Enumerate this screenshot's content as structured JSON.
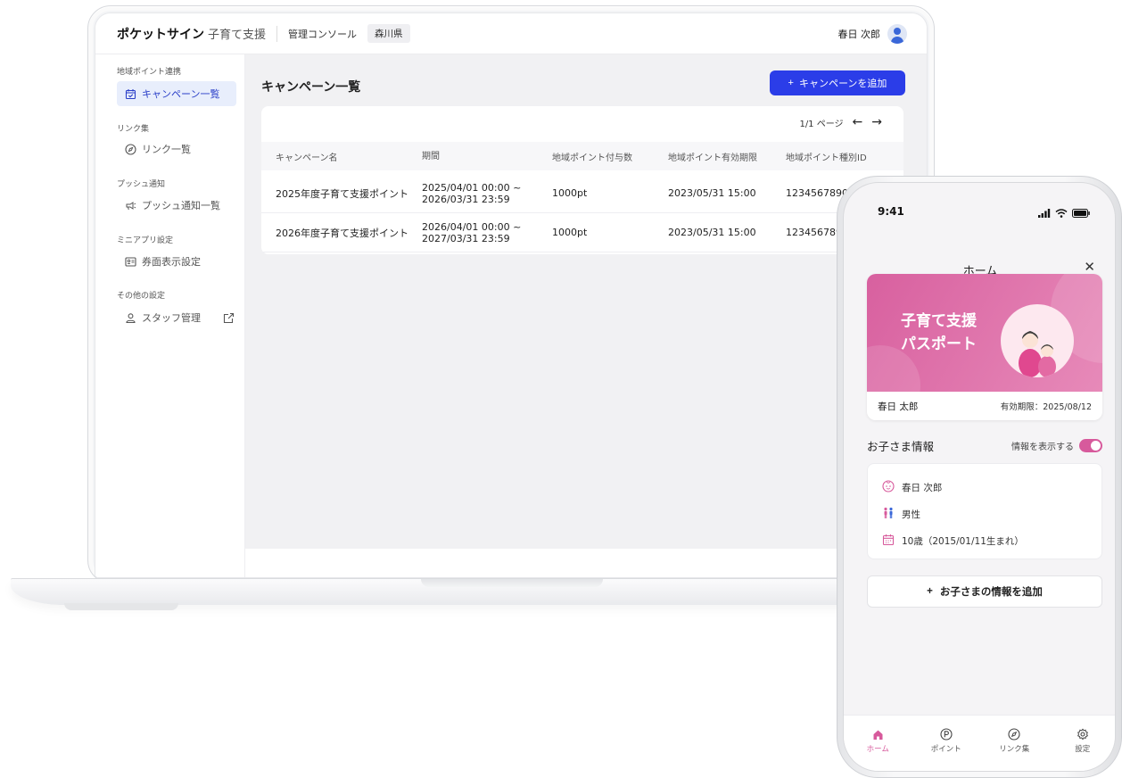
{
  "console": {
    "brand": "ポケットサイン",
    "brand_sub": "子育て支援",
    "nav_link": "管理コンソール",
    "prefecture": "森川県",
    "user_name": "春日 次郎"
  },
  "sidebar": {
    "sections": [
      {
        "label": "地域ポイント連携",
        "item": "キャンペーン一覧",
        "icon": "calendar-check-icon",
        "active": true
      },
      {
        "label": "リンク集",
        "item": "リンク一覧",
        "icon": "compass-icon"
      },
      {
        "label": "プッシュ通知",
        "item": "プッシュ通知一覧",
        "icon": "megaphone-icon"
      },
      {
        "label": "ミニアプリ設定",
        "item": "券面表示設定",
        "icon": "id-card-icon"
      },
      {
        "label": "その他の設定",
        "item": "スタッフ管理",
        "icon": "user-icon"
      }
    ]
  },
  "main": {
    "title": "キャンペーン一覧",
    "add_button": "キャンペーンを追加",
    "pager": "1/1 ページ",
    "columns": [
      "キャンペーン名",
      "期間",
      "地域ポイント付与数",
      "地域ポイント有効期限",
      "地域ポイント種別ID"
    ],
    "rows": [
      {
        "name": "2025年度子育て支援ポイント…",
        "period_start": "2025/04/01 00:00 ~",
        "period_end": "2026/03/31 23:59",
        "points": "1000pt",
        "expiry": "2023/05/31 15:00",
        "type_id": "1234567890"
      },
      {
        "name": "2026年度子育て支援ポイント…",
        "period_start": "2026/04/01 00:00 ~",
        "period_end": "2027/03/31 23:59",
        "points": "1000pt",
        "expiry": "2023/05/31 15:00",
        "type_id": "123456789"
      }
    ]
  },
  "phone": {
    "time": "9:41",
    "nav_title": "ホーム",
    "pass": {
      "title_line1": "子育て支援",
      "title_line2": "パスポート",
      "holder": "春日 太郎",
      "expiry": "有効期限：2025/08/12",
      "color": "#d8609f"
    },
    "child_section": {
      "title": "お子さま情報",
      "toggle_label": "情報を表示する",
      "toggle_on": true,
      "name": "春日 次郎",
      "gender": "男性",
      "age": "10歳（2015/01/11生まれ）"
    },
    "add_child_button": "お子さまの情報を追加",
    "tabs": [
      {
        "label": "ホーム",
        "active": true
      },
      {
        "label": "ポイント"
      },
      {
        "label": "リンク集"
      },
      {
        "label": "設定"
      }
    ]
  },
  "colors": {
    "accent_blue": "#2b3de8",
    "accent_pink": "#d75a9c"
  }
}
